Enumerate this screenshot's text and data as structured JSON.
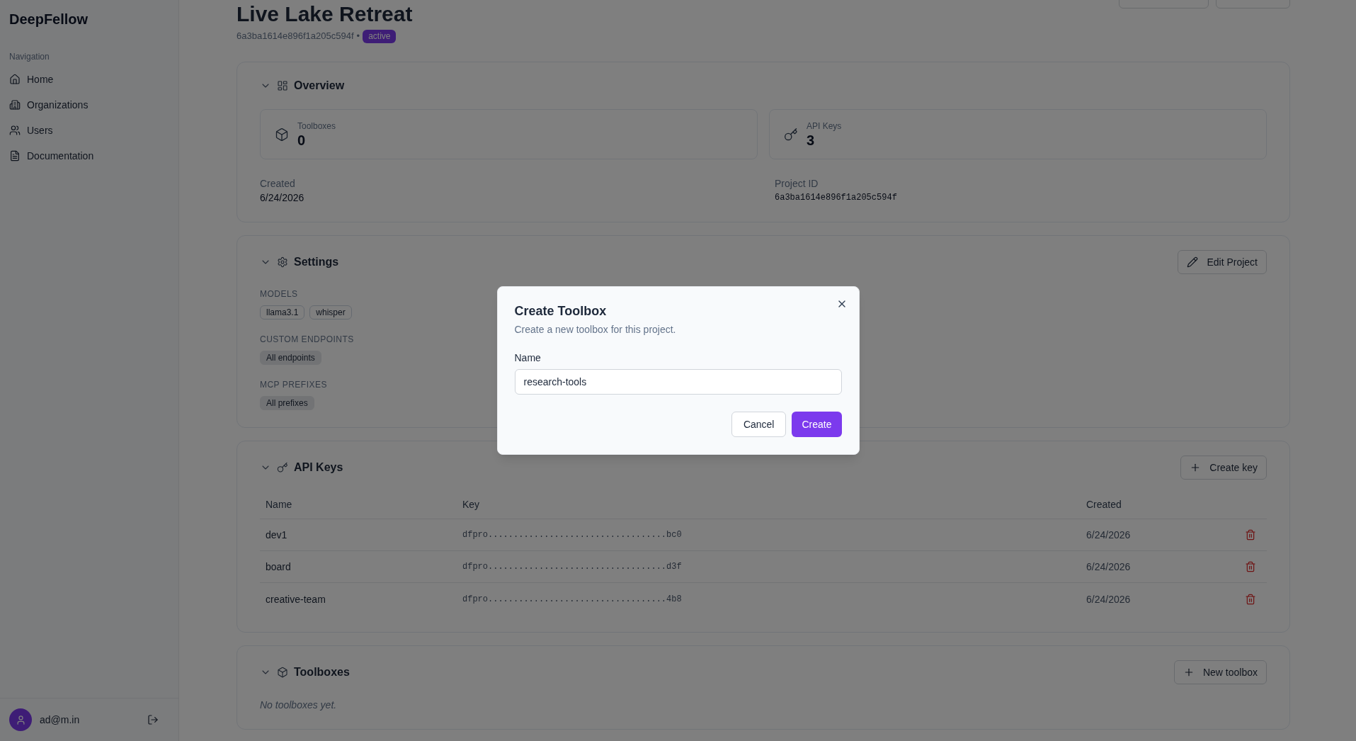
{
  "sidebar": {
    "brand": "DeepFellow",
    "section_label": "Navigation",
    "items": [
      {
        "label": "Home",
        "selected": false
      },
      {
        "label": "Organizations",
        "selected": false
      },
      {
        "label": "Users",
        "selected": false
      },
      {
        "label": "Documentation",
        "selected": false
      }
    ],
    "user": {
      "email": "ad@m.in"
    }
  },
  "header": {
    "title": "Live Lake Retreat",
    "project_id": "6a3ba1614e896f1a205c594f",
    "separator": "•",
    "status": "active"
  },
  "overview": {
    "title": "Overview",
    "expanded": true,
    "stats": [
      {
        "label": "Toolboxes",
        "value": "0"
      },
      {
        "label": "API Keys",
        "value": "3"
      }
    ],
    "fields": [
      {
        "label": "Created",
        "value": "6/24/2026",
        "kind": "text"
      },
      {
        "label": "Project ID",
        "value": "6a3ba1614e896f1a205c594f",
        "kind": "code"
      }
    ]
  },
  "settings": {
    "title": "Settings",
    "expanded": true,
    "action": "Edit Project",
    "groups": [
      {
        "label": "MODELS",
        "tags": [
          {
            "text": "llama3.1",
            "kind": "outline"
          },
          {
            "text": "whisper",
            "kind": "outline"
          }
        ]
      },
      {
        "label": "CUSTOM ENDPOINTS",
        "tags": [
          {
            "text": "All endpoints",
            "kind": "filled"
          }
        ]
      },
      {
        "label": "MCP PREFIXES",
        "tags": [
          {
            "text": "All prefixes",
            "kind": "filled"
          }
        ]
      }
    ]
  },
  "api_keys": {
    "title": "API Keys",
    "expanded": true,
    "action": "Create key",
    "table": {
      "columns": [
        "Name",
        "Key",
        "Created"
      ],
      "rows": [
        {
          "name": "dev1",
          "key": "dfpro...................................bc0",
          "created": "6/24/2026"
        },
        {
          "name": "board",
          "key": "dfpro...................................d3f",
          "created": "6/24/2026"
        },
        {
          "name": "creative-team",
          "key": "dfpro...................................4b8",
          "created": "6/24/2026"
        }
      ]
    }
  },
  "toolboxes": {
    "title": "Toolboxes",
    "expanded": true,
    "action": "New toolbox",
    "empty_text": "No toolboxes yet."
  },
  "dialog": {
    "title": "Create Toolbox",
    "description": "Create a new toolbox for this project.",
    "field": {
      "label": "Name",
      "value": "research-tools"
    },
    "buttons": [
      {
        "label": "Cancel",
        "kind": "outline"
      },
      {
        "label": "Create",
        "kind": "primary"
      }
    ]
  }
}
